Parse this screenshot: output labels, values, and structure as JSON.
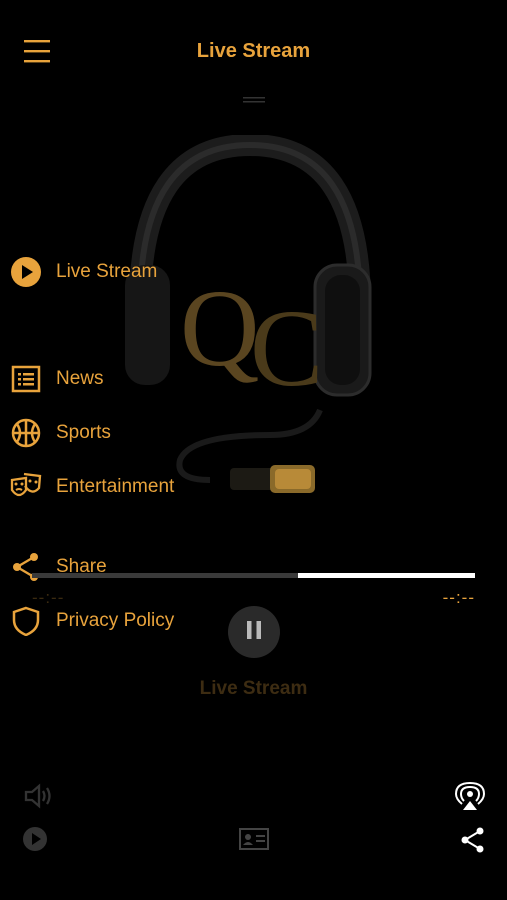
{
  "header": {
    "title": "Live Stream"
  },
  "sidebar": {
    "items": [
      {
        "label": "Live Stream",
        "icon": "play-circle-icon"
      },
      {
        "label": "News",
        "icon": "list-icon"
      },
      {
        "label": "Sports",
        "icon": "basketball-icon"
      },
      {
        "label": "Entertainment",
        "icon": "theater-masks-icon"
      },
      {
        "label": "Share",
        "icon": "share-icon"
      },
      {
        "label": "Privacy Policy",
        "icon": "shield-icon"
      }
    ]
  },
  "player": {
    "title": "Live Stream",
    "elapsed": "--:--",
    "remaining": "--:--",
    "progress": 0.4,
    "artwork": "QC headphones logo"
  },
  "toolbar": {
    "volume_icon": "volume-icon",
    "airplay_icon": "airplay-icon",
    "play_icon": "play-icon",
    "card_icon": "contact-card-icon",
    "share_icon": "share-icon"
  },
  "colors": {
    "accent": "#e8a33c",
    "background": "#000000"
  }
}
